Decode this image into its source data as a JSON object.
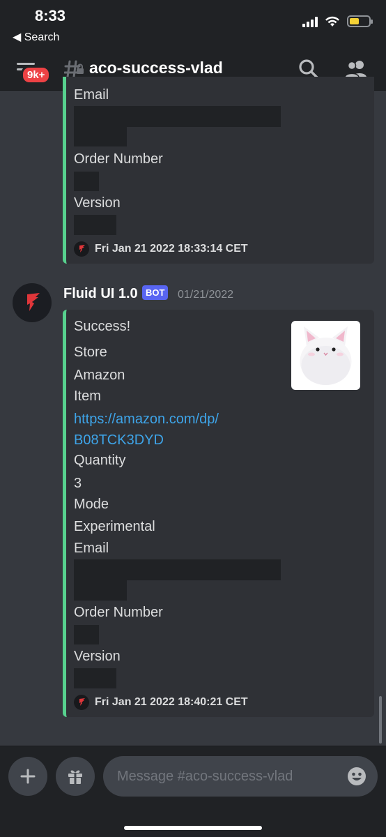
{
  "status_bar": {
    "time": "8:33",
    "back_label": "◀ Search"
  },
  "header": {
    "badge": "9k+",
    "channel_name": "aco-success-vlad"
  },
  "embed_top": {
    "fields": [
      "Email",
      "Order Number",
      "Version"
    ],
    "footer_text": "Fri Jan 21 2022 18:33:14 CET"
  },
  "message": {
    "author": "Fluid UI 1.0",
    "bot_tag": "BOT",
    "date": "01/21/2022",
    "embed": {
      "title": "Success!",
      "store_label": "Store",
      "store_value": "Amazon",
      "item_label": "Item",
      "item_link_line1": "https://amazon.com/dp/",
      "item_link_line2": "B08TCK3DYD",
      "quantity_label": "Quantity",
      "quantity_value": "3",
      "mode_label": "Mode",
      "mode_value": "Experimental",
      "email_label": "Email",
      "order_label": "Order Number",
      "version_label": "Version",
      "footer_text": "Fri Jan 21 2022 18:40:21 CET"
    }
  },
  "composer": {
    "placeholder": "Message #aco-success-vlad"
  },
  "colors": {
    "accent_green": "#57d18e",
    "bot_blurple": "#5865f2",
    "badge_red": "#ed4245",
    "link_blue": "#3ea4e8"
  }
}
